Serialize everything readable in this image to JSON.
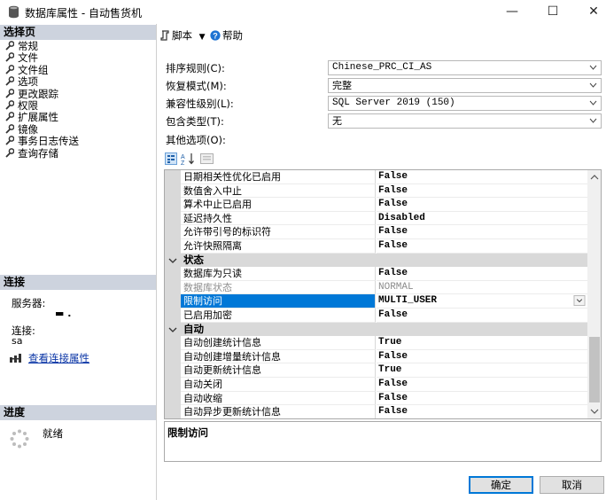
{
  "window": {
    "title": "数据库属性 - 自动售货机",
    "minimize_glyph": "—",
    "maximize_glyph": "☐",
    "close_glyph": "✕"
  },
  "left": {
    "select_page_header": "选择页",
    "pages": [
      "常规",
      "文件",
      "文件组",
      "选项",
      "更改跟踪",
      "权限",
      "扩展属性",
      "镜像",
      "事务日志传送",
      "查询存储"
    ],
    "connection_header": "连接",
    "server_label": "服务器:",
    "server_value": "▬ .",
    "connection_label": "连接:",
    "connection_value": "sa",
    "view_connection_props": "查看连接属性",
    "progress_header": "进度",
    "progress_status": "就绪"
  },
  "toolbar": {
    "script_label": "脚本",
    "help_label": "帮助"
  },
  "options": {
    "collation_label": "排序规则(C):",
    "collation_value": "Chinese_PRC_CI_AS",
    "recovery_label": "恢复模式(M):",
    "recovery_value": "完整",
    "compat_label": "兼容性级别(L):",
    "compat_value": "SQL Server 2019 (150)",
    "containment_label": "包含类型(T):",
    "containment_value": "无",
    "other_label": "其他选项(O):"
  },
  "grid": {
    "rows": [
      {
        "name": "日期相关性优化已启用",
        "value": "False"
      },
      {
        "name": "数值舍入中止",
        "value": "False"
      },
      {
        "name": "算术中止已启用",
        "value": "False"
      },
      {
        "name": "延迟持久性",
        "value": "Disabled"
      },
      {
        "name": "允许带引号的标识符",
        "value": "False"
      },
      {
        "name": "允许快照隔离",
        "value": "False"
      },
      {
        "category": "状态"
      },
      {
        "name": "数据库为只读",
        "value": "False"
      },
      {
        "name": "数据库状态",
        "value": "NORMAL",
        "disabled": true
      },
      {
        "name": "限制访问",
        "value": "MULTI_USER",
        "selected": true
      },
      {
        "name": "已启用加密",
        "value": "False"
      },
      {
        "category": "自动"
      },
      {
        "name": "自动创建统计信息",
        "value": "True"
      },
      {
        "name": "自动创建增量统计信息",
        "value": "False"
      },
      {
        "name": "自动更新统计信息",
        "value": "True"
      },
      {
        "name": "自动关闭",
        "value": "False"
      },
      {
        "name": "自动收缩",
        "value": "False"
      },
      {
        "name": "自动异步更新统计信息",
        "value": "False"
      }
    ]
  },
  "description": {
    "title": "限制访问"
  },
  "buttons": {
    "ok": "确定",
    "cancel": "取消"
  },
  "colors": {
    "selection": "#0078d7",
    "section_header": "#cdd3de",
    "link": "#0a35a6"
  }
}
